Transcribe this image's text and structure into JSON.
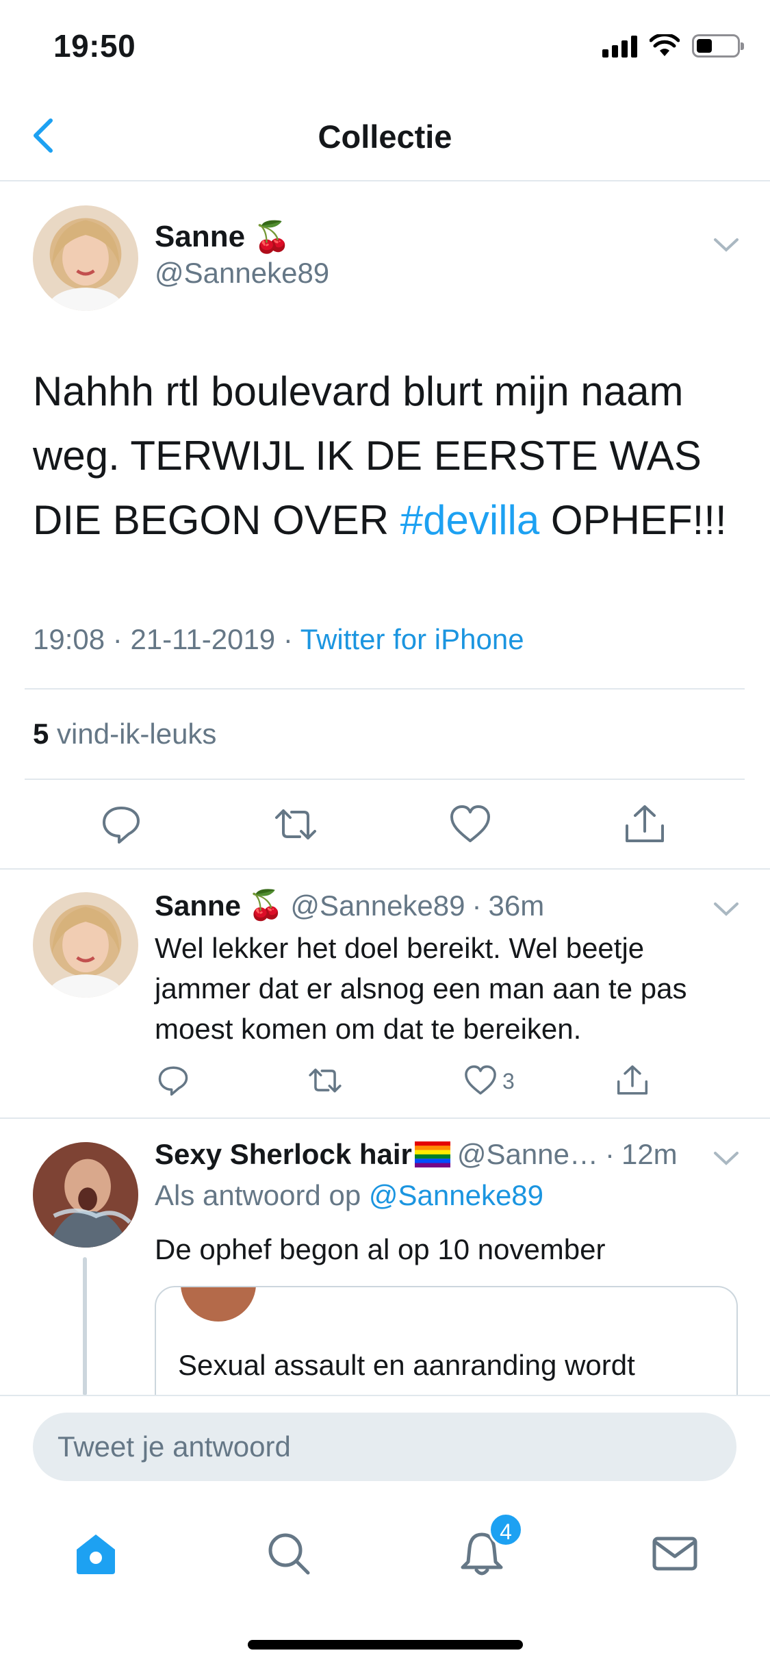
{
  "status_bar": {
    "time": "19:50"
  },
  "header": {
    "title": "Collectie"
  },
  "main_tweet": {
    "author_name": "Sanne",
    "author_emoji": "🍒",
    "author_handle": "@Sanneke89",
    "text_before_hashtag": "Nahhh rtl boulevard blurt mijn naam weg. TERWIJL IK DE EERSTE WAS DIE BEGON OVER ",
    "hashtag": "#devilla",
    "text_after_hashtag": " OPHEF!!!",
    "time": "19:08",
    "date": "21-11-2019",
    "source": "Twitter for iPhone",
    "likes_count": "5",
    "likes_label": "vind-ik-leuks"
  },
  "replies": [
    {
      "author_name": "Sanne",
      "author_emoji": "🍒",
      "author_handle": "@Sanneke89",
      "time": "36m",
      "text": "Wel lekker het doel bereikt. Wel beetje jammer dat er alsnog een man aan te pas moest komen om dat te bereiken.",
      "like_count": "3"
    },
    {
      "author_name": "Sexy Sherlock hair",
      "author_handle": "@Sanne…",
      "time": "12m",
      "replying_prefix": "Als antwoord op",
      "replying_to": "@Sanneke89",
      "text": "De ophef begon al op 10 november",
      "quote_text": "Sexual assault en aanranding wordt"
    }
  ],
  "composer": {
    "placeholder": "Tweet je antwoord"
  },
  "tab_bar": {
    "notifications_badge": "4"
  },
  "colors": {
    "accent": "#1da1f2",
    "secondary_text": "#657786",
    "divider": "#e1e8ed"
  }
}
